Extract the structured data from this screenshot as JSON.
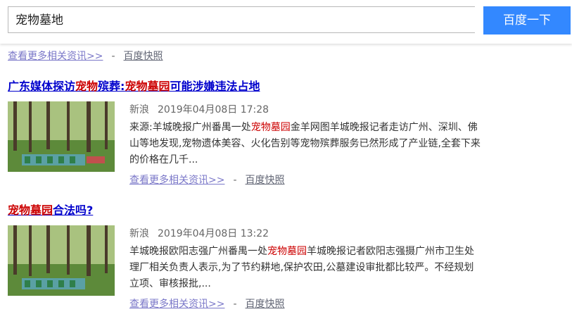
{
  "search": {
    "query": "宠物墓地",
    "button_label": "百度一下"
  },
  "top_links": {
    "more": "查看更多相关资讯>>",
    "sep": "-",
    "snapshot": "百度快照"
  },
  "results": [
    {
      "title_parts": [
        "广东媒体探访",
        "宠物",
        "殡葬:",
        "宠物墓园",
        "可能涉嫌违法占地"
      ],
      "source": "新浪",
      "date": "2019年04月08日 17:28",
      "abstract_parts": [
        "来源:羊城晚报广州番禺一处",
        "宠物墓园",
        "金羊网图羊城晚报记者走访广州、深圳、佛山等地发现,宠物遗体美容、火化告别等宠物殡葬服务已然形成了产业链,全套下来的价格在几千..."
      ],
      "more": "查看更多相关资讯>>",
      "sep": "-",
      "snapshot": "百度快照"
    },
    {
      "title_parts": [
        "宠物墓园",
        "合法吗?"
      ],
      "source": "新浪",
      "date": "2019年04月08日 13:22",
      "abstract_parts": [
        "羊城晚报欧阳志强广州番禺一处",
        "宠物墓园",
        "羊城晚报记者欧阳志强摄广州市卫生处理厂相关负责人表示,为了节约耕地,保护农田,公墓建设审批都比较严。不经规划立项、审核报批,..."
      ],
      "more": "查看更多相关资讯>>",
      "sep": "-",
      "snapshot": "百度快照"
    }
  ]
}
